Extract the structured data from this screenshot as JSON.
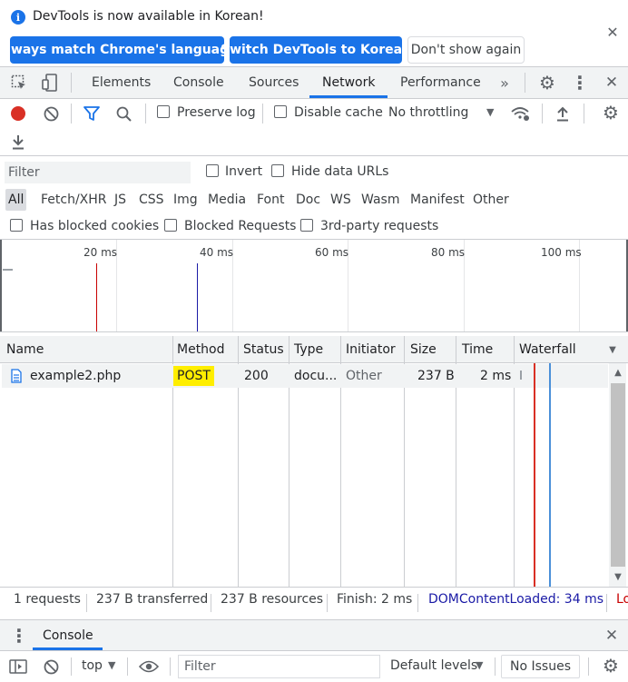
{
  "infobar": {
    "message": "DevTools is now available in Korean!",
    "buttons": {
      "match_language": "Always match Chrome's language",
      "switch_language": "Switch DevTools to Korean",
      "dont_show": "Don't show again"
    }
  },
  "main_tabs": [
    "Elements",
    "Console",
    "Sources",
    "Network",
    "Performance"
  ],
  "active_tab": "Network",
  "toolbar": {
    "preserve_log": "Preserve log",
    "disable_cache": "Disable cache",
    "throttling": "No throttling"
  },
  "filter": {
    "placeholder": "Filter",
    "invert": "Invert",
    "hide_data_urls": "Hide data URLs"
  },
  "type_filters": [
    "All",
    "Fetch/XHR",
    "JS",
    "CSS",
    "Img",
    "Media",
    "Font",
    "Doc",
    "WS",
    "Wasm",
    "Manifest",
    "Other"
  ],
  "active_type_filter": "All",
  "extra_filters": {
    "blocked_cookies": "Has blocked cookies",
    "blocked_requests": "Blocked Requests",
    "third_party": "3rd-party requests"
  },
  "overview_ticks": [
    "20 ms",
    "40 ms",
    "60 ms",
    "80 ms",
    "100 ms"
  ],
  "table": {
    "columns": [
      "Name",
      "Method",
      "Status",
      "Type",
      "Initiator",
      "Size",
      "Time",
      "Waterfall"
    ],
    "rows": [
      {
        "name": "example2.php",
        "method": "POST",
        "status": "200",
        "type": "docu...",
        "initiator": "Other",
        "size": "237 B",
        "time": "2 ms"
      }
    ]
  },
  "status_bar": {
    "requests": "1 requests",
    "transferred": "237 B transferred",
    "resources": "237 B resources",
    "finish": "Finish: 2 ms",
    "dom_content_loaded": "DOMContentLoaded: 34 ms",
    "load_truncated": "Lo"
  },
  "drawer": {
    "tab": "Console",
    "context": "top",
    "filter_placeholder": "Filter",
    "levels": "Default levels",
    "issues": "No Issues"
  },
  "colors": {
    "accent": "#1a73e8",
    "record_red": "#d93025",
    "highlight": "#ffee00",
    "dom_content_loaded": "#1a1aa6",
    "load": "#c80000"
  }
}
